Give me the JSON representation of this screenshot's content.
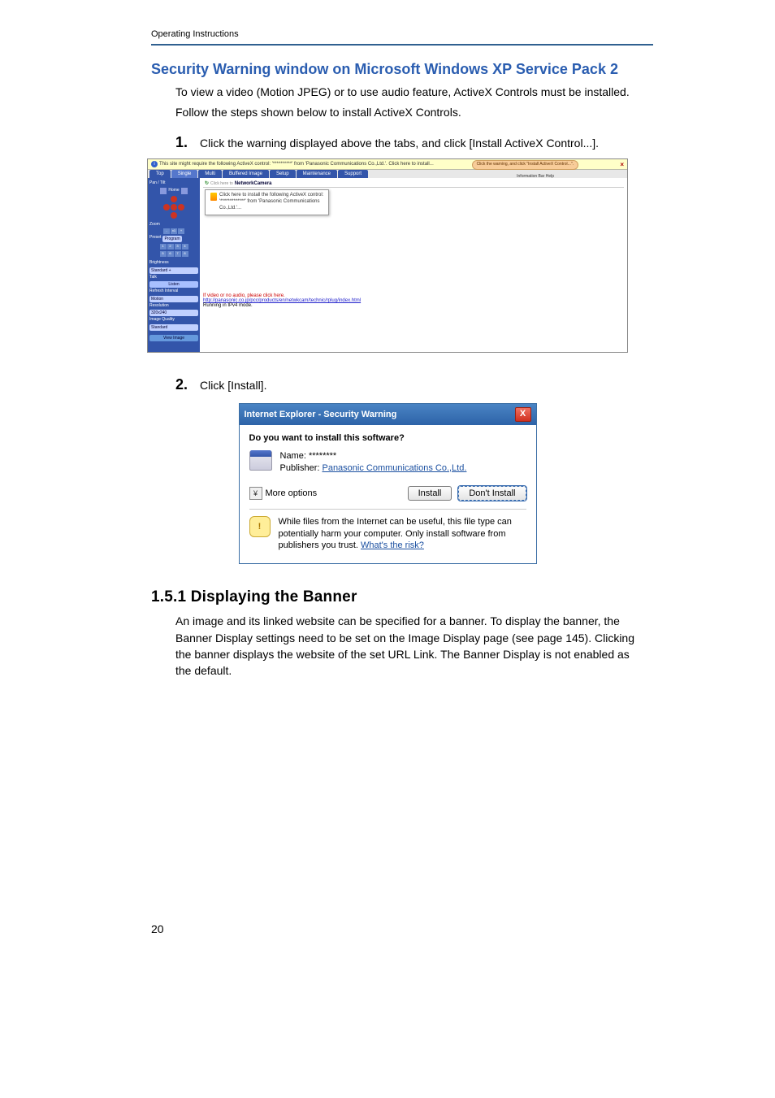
{
  "header": {
    "title": "Operating Instructions"
  },
  "section_title": "Security Warning window on Microsoft Windows XP Service Pack 2",
  "intro": {
    "p1": "To view a video (Motion JPEG) or to use audio feature, ActiveX Controls must be installed.",
    "p2": "Follow the steps shown below to install ActiveX Controls."
  },
  "steps": {
    "s1": {
      "num": "1.",
      "text": "Click the warning displayed above the tabs, and click [Install ActiveX Control...]."
    },
    "s2": {
      "num": "2.",
      "text": "Click [Install]."
    }
  },
  "fig1": {
    "infobar": "This site might require the following ActiveX control: '**********' from 'Panasonic Communications Co.,Ltd.'. Click here to install...",
    "close_x": "×",
    "callout_main": "Click the warning, and click \"Install ActiveX Control...\".",
    "callout_sub": "Information Bar Help",
    "tabs": {
      "top": "Top",
      "single": "Single",
      "multi": "Multi",
      "buffered": "Buffered Image",
      "setup": "Setup",
      "maintenance": "Maintenance",
      "support": "Support"
    },
    "titlebar": {
      "refresh": "↻",
      "clickhere": "Click here to",
      "camname": "NetworkCamera"
    },
    "popup": {
      "line1": "Click here to install the following ActiveX control:",
      "line2": "'*************' from 'Panasonic Communications",
      "line3": "Co.,Ltd.'..."
    },
    "sidebar": {
      "pantilt": "Pan / Tilt",
      "home": "Home",
      "zoom": "Zoom",
      "preset_label": "Preset",
      "program": "Program",
      "brightness": "Brightness",
      "standard": "Standard +",
      "talk": "Talk",
      "listen": "Listen",
      "refresh_interval": "Refresh Interval",
      "motion": "Motion",
      "resolution": "Resolution",
      "r320": "320x240",
      "image_quality": "Image Quality",
      "standard2": "Standard",
      "view_image": "View Image"
    },
    "bottom": {
      "red1": "If video or no audio, please click here.",
      "link": "http://panasonic.co.jp/pcc/products/en/netwkcam/technic/rplug/index.html",
      "bold": "Running in IPv4 mode."
    }
  },
  "dialog": {
    "title": "Internet Explorer - Security Warning",
    "close_x": "X",
    "question": "Do you want to install this software?",
    "name_label": "Name:",
    "name_value": "********",
    "publisher_label": "Publisher:",
    "publisher_value": "Panasonic Communications Co.,Ltd.",
    "more_options_chevron": "¥",
    "more_options": "More options",
    "install_btn": "Install",
    "dont_install_btn": "Don't Install",
    "warning_icon": "!",
    "warning_text": "While files from the Internet can be useful, this file type can potentially harm your computer. Only install software from publishers you trust. ",
    "whats_risk": "What's the risk?"
  },
  "subhead": "1.5.1    Displaying the Banner",
  "banner_paragraph": "An image and its linked website can be specified for a banner. To display the banner, the Banner Display settings need to be set on the Image Display page (see page 145). Clicking the banner displays the website of the set URL Link. The Banner Display is not enabled as the default.",
  "page_number": "20"
}
